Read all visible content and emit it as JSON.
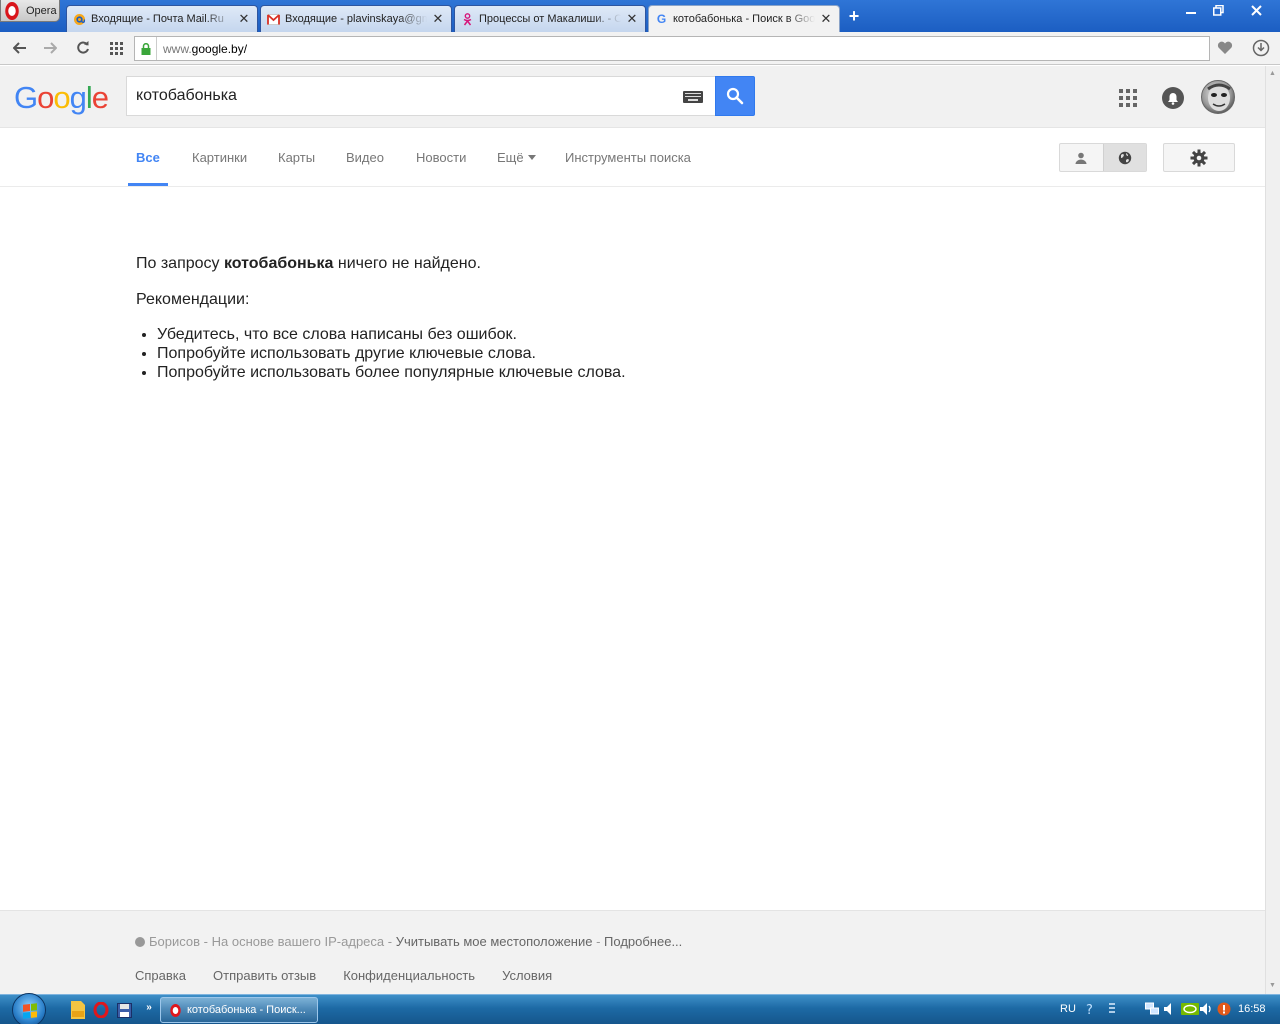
{
  "browser": {
    "menu_label": "Opera",
    "tabs": [
      {
        "title": "Входящие - Почта Mail.Ru",
        "icon": "mailru-at-icon"
      },
      {
        "title": "Входящие - plavinskaya@gmail.com",
        "icon": "gmail-icon"
      },
      {
        "title": "Процессы от Макалиши. - Одноклассники",
        "icon": "odnoklassniki-icon"
      },
      {
        "title": "котобабонька - Поиск в Google",
        "icon": "google-g-icon",
        "active": true
      }
    ],
    "close_glyph": "✕",
    "new_tab_glyph": "+",
    "url_proto": "www.",
    "url_host": "google.by/"
  },
  "google": {
    "logo_letters": [
      "G",
      "o",
      "o",
      "g",
      "l",
      "e"
    ],
    "logo_colors": [
      "#4285f4",
      "#ea4335",
      "#fbbc05",
      "#4285f4",
      "#34a853",
      "#ea4335"
    ],
    "query": "котобабонька",
    "accent": "#4285f4"
  },
  "nav": {
    "tabs": [
      "Все",
      "Картинки",
      "Карты",
      "Видео",
      "Новости",
      "Ещё",
      "Инструменты поиска"
    ],
    "active_tab": "Все"
  },
  "results": {
    "no_result_prefix": "По запросу ",
    "no_result_query": "котобабонька",
    "no_result_suffix": " ничего не найдено.",
    "recommend_title": "Рекомендации:",
    "tips": [
      "Убедитесь, что все слова написаны без ошибок.",
      "Попробуйте использовать другие ключевые слова.",
      "Попробуйте использовать более популярные ключевые слова."
    ]
  },
  "footer": {
    "location": "Борисов",
    "location_sep1": " - ",
    "location_basis": "На основе вашего IP-адреса",
    "location_sep2": " - ",
    "use_location": "Учитывать мое местоположение",
    "location_sep3": " - ",
    "more": "Подробнее...",
    "links": [
      "Справка",
      "Отправить отзыв",
      "Конфиденциальность",
      "Условия"
    ]
  },
  "taskbar": {
    "task_label": "котобабонька - Поиск...",
    "language": "RU",
    "time": "16:58",
    "quicklaunch_more": "»"
  }
}
